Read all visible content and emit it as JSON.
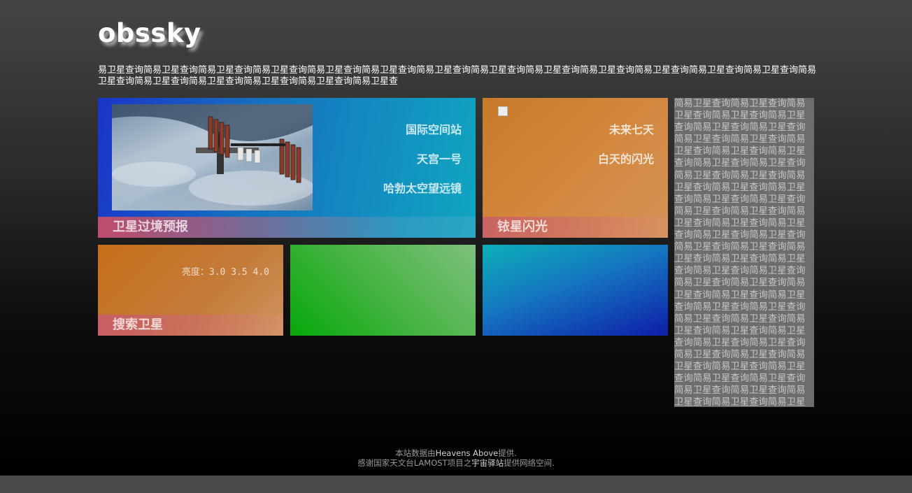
{
  "site": {
    "logo": "obssky",
    "intro": "易卫星查询简易卫星查询简易卫星查询简易卫星查询简易卫星查询简易卫星查询简易卫星查询简易卫星查询简易卫星查询简易卫星查询简易卫星查询简易卫星查询简易卫星查询简易卫星查询简易卫星查询简易卫星查询简易卫星查询简易卫星查询简易卫星查"
  },
  "tiles": {
    "pass": {
      "label": "卫星过境预报",
      "links": [
        "国际空间站",
        "天宫一号",
        "哈勃太空望远镜"
      ]
    },
    "iridium": {
      "label": "铱星闪光",
      "links": [
        "未来七天",
        "白天的闪光"
      ]
    },
    "search": {
      "label": "搜索卫星",
      "brightness": "亮度：3.0  3.5  4.0"
    }
  },
  "sidebar": {
    "text": "简易卫星查询简易卫星查询简易卫星查询简易卫星查询简易卫星查询简易卫星查询简易卫星查询简易卫星查询简易卫星查询简易卫星查询简易卫星查询简易卫星查询简易卫星查询简易卫星查询简易卫星查询简易卫星查询简易卫星查询简易卫星查询简易卫星查询简易卫星查询简易卫星查询简易卫星查询简易卫星查询简易卫星查询简易卫星查询简易卫星查询简易卫星查询简易卫星查询简易卫星查询简易卫星查询简易卫星查询简易卫星查询简易卫星查询简易卫星查询简易卫星查询简易卫星查询简易卫星查询简易卫星查询简易卫星查询简易卫星查询简易卫星查询简易卫星查询简易卫星查询简易卫星查询简易卫星查询简易卫星查询简易卫星查询简易卫星查询简易卫星查询简易卫星查询简易卫星查询简易卫星查询简易卫星查询简易卫星查询简易卫星查询简易卫星查询简易卫星查询简易卫星查询简易卫星查询简易卫星查询简易卫星查询简易卫星查询简易卫星查询简易卫星查询简易卫星查询简易卫星查询简易卫星查询简易卫星查询"
  },
  "footer": {
    "line1_pre": "本站数据由",
    "line1_link": "Heavens Above",
    "line1_post": "提供.",
    "line2_pre": "感谢国家天文台LAMOST项目之",
    "line2_link": "宇宙驿站",
    "line2_post": "提供网络空间."
  },
  "colors": {
    "tile_blue": "#1670c0",
    "tile_orange": "#c87a2a",
    "tile_green": "#4eb54a",
    "sidebar_bg": "#6d6d6d"
  }
}
